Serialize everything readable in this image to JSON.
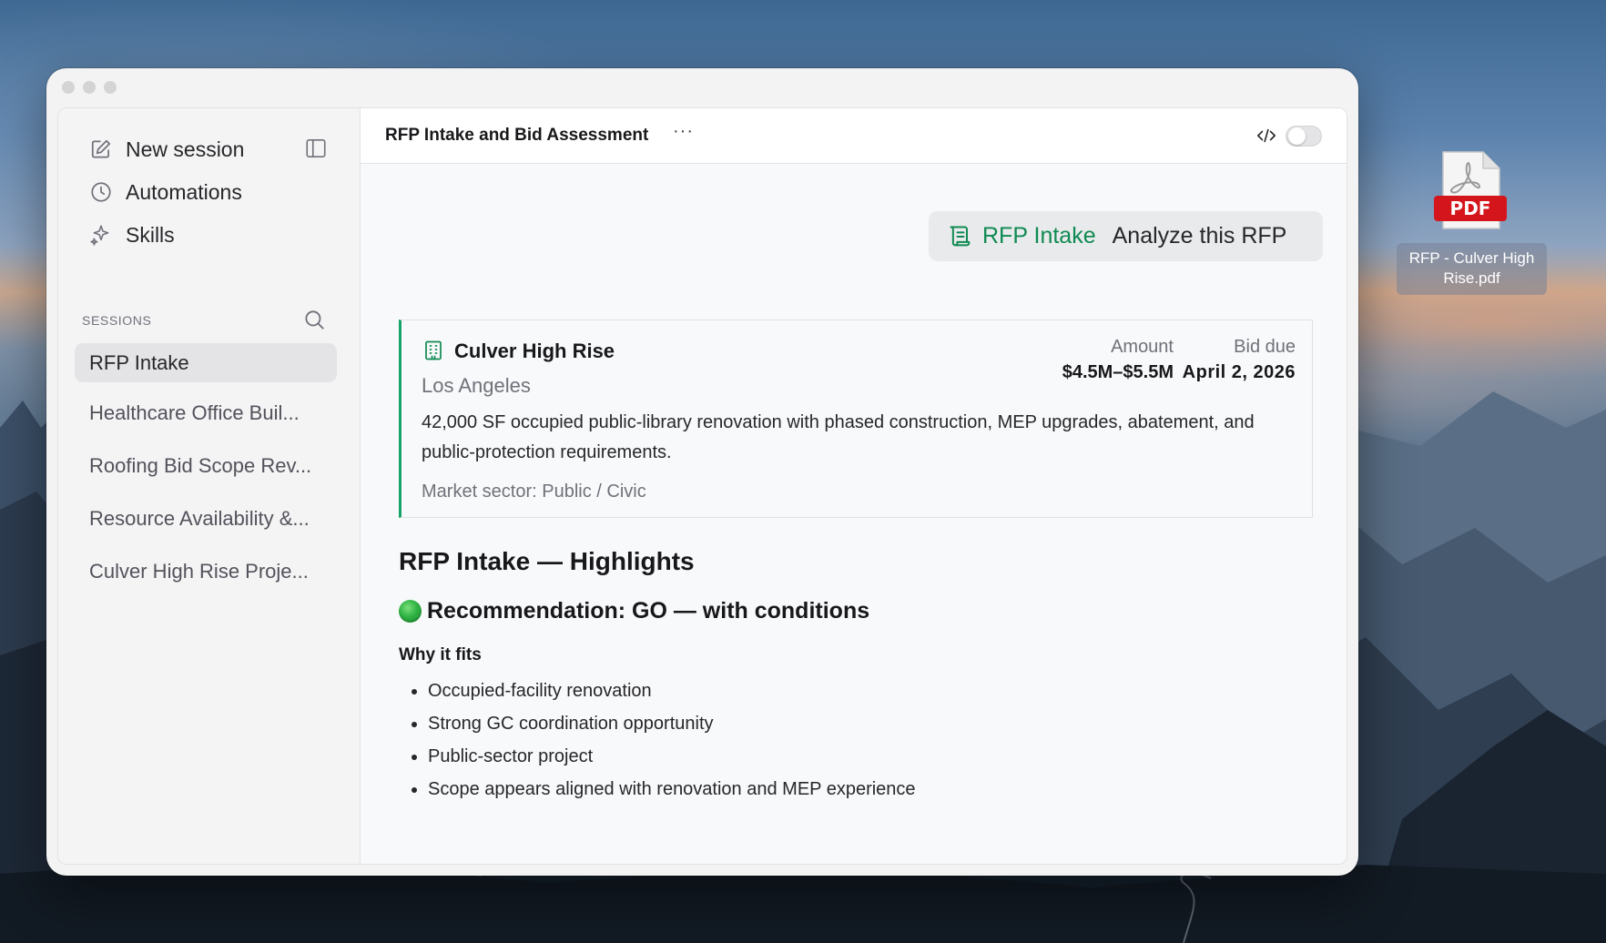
{
  "window": {
    "sidebar": {
      "nav": [
        {
          "label": "New session",
          "icon": "edit-icon"
        },
        {
          "label": "Automations",
          "icon": "clock-icon"
        },
        {
          "label": "Skills",
          "icon": "sparkle-icon"
        }
      ],
      "sessions_header": "SESSIONS",
      "sessions": [
        {
          "label": "RFP Intake",
          "active": true
        },
        {
          "label": "Healthcare Office Buil...",
          "active": false
        },
        {
          "label": "Roofing Bid Scope Rev...",
          "active": false
        },
        {
          "label": "Resource Availability &...",
          "active": false
        },
        {
          "label": "Culver High Rise Proje...",
          "active": false
        }
      ]
    },
    "topbar": {
      "title": "RFP Intake and Bid Assessment",
      "more_label": "···",
      "code_toggle_on": false
    },
    "user_message": {
      "tag": "RFP Intake",
      "text": "Analyze this RFP"
    },
    "project_card": {
      "title": "Culver High Rise",
      "city": "Los Angeles",
      "amount_label": "Amount",
      "amount": "$4.5M–$5.5M",
      "due_label": "Bid due",
      "due": "April 2, 2026",
      "description": "42,000 SF occupied public-library renovation with phased construction, MEP upgrades, abatement, and public-protection requirements.",
      "sector": "Market sector: Public / Civic"
    },
    "response": {
      "heading": "RFP Intake — Highlights",
      "recommendation": "Recommendation: GO — with conditions",
      "why_heading": "Why it fits",
      "bullets": [
        "Occupied-facility renovation",
        "Strong GC coordination opportunity",
        "Public-sector project",
        "Scope appears aligned with renovation and MEP experience"
      ]
    }
  },
  "desktop": {
    "file_badge": "PDF",
    "file_name": "RFP - Culver High Rise.pdf"
  },
  "colors": {
    "accent_green": "#0f8a52",
    "card_border_green": "#16a36a"
  }
}
